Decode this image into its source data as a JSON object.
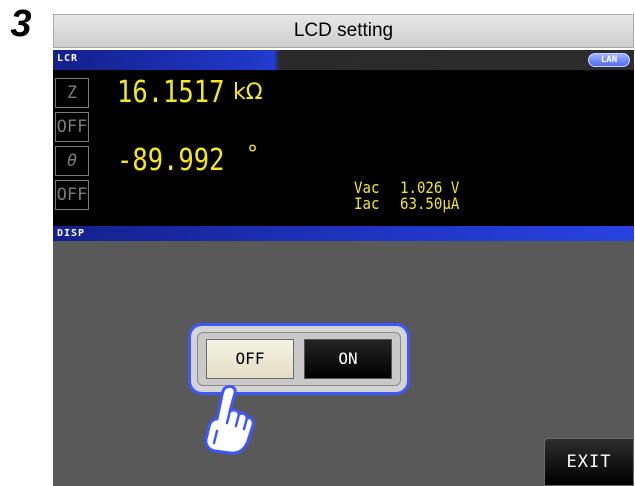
{
  "step": {
    "number": "3"
  },
  "window": {
    "title": "LCD setting"
  },
  "status_bar": {
    "label": "LCR",
    "lan_badge": "LAN"
  },
  "params": [
    {
      "label": "Z",
      "value": "16.1517",
      "unit": "kΩ"
    },
    {
      "label": "OFF",
      "value": "",
      "unit": ""
    },
    {
      "label": "θ",
      "value": "-89.992",
      "unit": "°"
    },
    {
      "label": "OFF",
      "value": "",
      "unit": ""
    }
  ],
  "monitor": {
    "vac_label": "Vac",
    "vac_value": "1.026 V",
    "iac_label": "Iac",
    "iac_value": "63.50μA"
  },
  "disp_bar": {
    "label": "DISP"
  },
  "lcd_toggle": {
    "off_label": "OFF",
    "on_label": "ON",
    "selected": "OFF"
  },
  "exit_button": {
    "label": "EXIT"
  },
  "icons": {
    "pointer": "hand-pointer-icon"
  },
  "colors": {
    "value_text": "#f4e81a",
    "status_blue": "#2036c6",
    "highlight": "#3f57ff",
    "panel": "#595959"
  }
}
